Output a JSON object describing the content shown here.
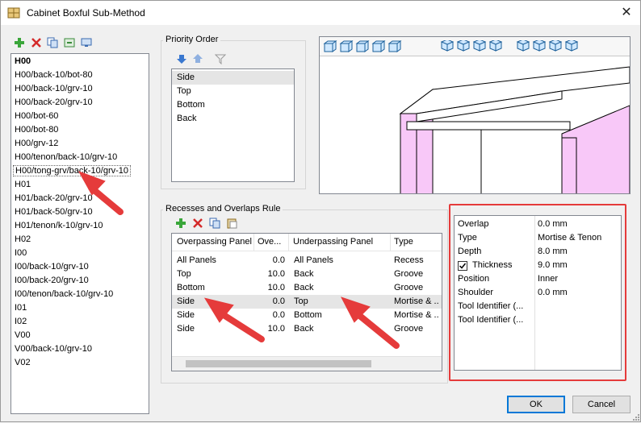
{
  "window": {
    "title": "Cabinet Boxful Sub-Method",
    "close_glyph": "✕"
  },
  "left_list": {
    "items": [
      "H00",
      "H00/back-10/bot-80",
      "H00/back-10/grv-10",
      "H00/back-20/grv-10",
      "H00/bot-60",
      "H00/bot-80",
      "H00/grv-12",
      "H00/tenon/back-10/grv-10",
      "H00/tong-grv/back-10/grv-10",
      "H01",
      "H01/back-20/grv-10",
      "H01/back-50/grv-10",
      "H01/tenon/k-10/grv-10",
      "H02",
      "I00",
      "I00/back-10/grv-10",
      "I00/back-20/grv-10",
      "I00/tenon/back-10/grv-10",
      "I01",
      "I02",
      "V00",
      "V00/back-10/grv-10",
      "V02"
    ]
  },
  "priority": {
    "title": "Priority Order",
    "items": [
      "Side",
      "Top",
      "Bottom",
      "Back"
    ]
  },
  "recesses": {
    "title": "Recesses and Overlaps Rule",
    "columns": [
      "Overpassing Panel",
      "Ove...",
      "Underpassing Panel",
      "Type"
    ],
    "rows": [
      [
        "All Panels",
        "0.0",
        "All Panels",
        "Recess"
      ],
      [
        "Top",
        "10.0",
        "Back",
        "Groove"
      ],
      [
        "Bottom",
        "10.0",
        "Back",
        "Groove"
      ],
      [
        "Side",
        "0.0",
        "Top",
        "Mortise & ..."
      ],
      [
        "Side",
        "0.0",
        "Bottom",
        "Mortise & ..."
      ],
      [
        "Side",
        "10.0",
        "Back",
        "Groove"
      ]
    ]
  },
  "properties": {
    "rows": [
      {
        "name": "Overlap",
        "value": "0.0 mm"
      },
      {
        "name": "Type",
        "value": "Mortise & Tenon"
      },
      {
        "name": "Depth",
        "value": "8.0 mm"
      },
      {
        "name": "Thickness",
        "value": "9.0 mm",
        "checked": true
      },
      {
        "name": "Position",
        "value": "Inner"
      },
      {
        "name": "Shoulder",
        "value": "0.0 mm"
      },
      {
        "name": "Tool Identifier (...",
        "value": ""
      },
      {
        "name": "Tool Identifier (...",
        "value": ""
      }
    ]
  },
  "buttons": {
    "ok": "OK",
    "cancel": "Cancel"
  },
  "colors": {
    "accent": "#0078d7",
    "highlight": "#e53b3b",
    "panel_pink": "#f8c8f8"
  }
}
